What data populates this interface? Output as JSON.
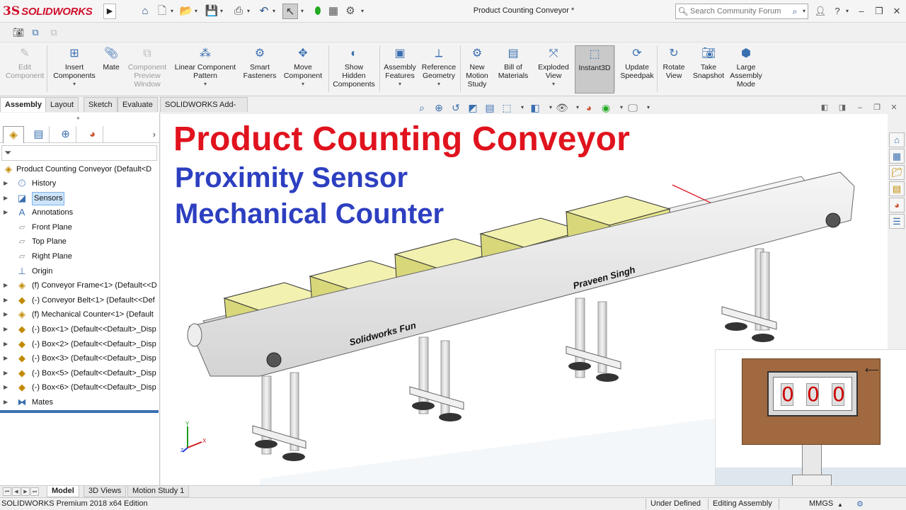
{
  "app": {
    "logo_ds": "3S",
    "logo_name": "SOLIDWORKS",
    "document_title": "Product Counting Conveyor *"
  },
  "search": {
    "placeholder": "Search Community Forum"
  },
  "ribbon": {
    "buttons": [
      {
        "label": "Edit\nComponent",
        "disabled": true
      },
      {
        "label": "Insert\nComponents",
        "dropdown": true
      },
      {
        "label": "Mate"
      },
      {
        "label": "Component\nPreview\nWindow",
        "disabled": true
      },
      {
        "label": "Linear Component\nPattern",
        "dropdown": true
      },
      {
        "label": "Smart\nFasteners"
      },
      {
        "label": "Move\nComponent",
        "dropdown": true
      },
      {
        "label": "Show\nHidden\nComponents"
      },
      {
        "label": "Assembly\nFeatures",
        "dropdown": true
      },
      {
        "label": "Reference\nGeometry",
        "dropdown": true
      },
      {
        "label": "New\nMotion\nStudy"
      },
      {
        "label": "Bill of\nMaterials"
      },
      {
        "label": "Exploded\nView",
        "dropdown": true
      },
      {
        "label": "Instant3D",
        "active": true
      },
      {
        "label": "Update\nSpeedpak"
      },
      {
        "label": "Rotate\nView"
      },
      {
        "label": "Take\nSnapshot"
      },
      {
        "label": "Large\nAssembly\nMode"
      }
    ]
  },
  "tabs": [
    "Assembly",
    "Layout",
    "Sketch",
    "Evaluate",
    "SOLIDWORKS Add-Ins"
  ],
  "tree": {
    "root": "Product Counting Conveyor  (Default<D",
    "items": [
      {
        "label": "History",
        "expandable": true
      },
      {
        "label": "Sensors",
        "expandable": true,
        "selected": true
      },
      {
        "label": "Annotations",
        "expandable": true
      },
      {
        "label": "Front Plane"
      },
      {
        "label": "Top Plane"
      },
      {
        "label": "Right Plane"
      },
      {
        "label": "Origin"
      },
      {
        "label": "(f) Conveyor Frame<1> (Default<<D",
        "expandable": true
      },
      {
        "label": "(-) Conveyor Belt<1> (Default<<Def",
        "expandable": true
      },
      {
        "label": "(f) Mechanical Counter<1> (Default",
        "expandable": true
      },
      {
        "label": "(-) Box<1> (Default<<Default>_Disp",
        "expandable": true
      },
      {
        "label": "(-) Box<2> (Default<<Default>_Disp",
        "expandable": true
      },
      {
        "label": "(-) Box<3> (Default<<Default>_Disp",
        "expandable": true
      },
      {
        "label": "(-) Box<5> (Default<<Default>_Disp",
        "expandable": true
      },
      {
        "label": "(-) Box<6> (Default<<Default>_Disp",
        "expandable": true
      },
      {
        "label": "Mates",
        "expandable": true
      }
    ]
  },
  "bottom_tabs": [
    "Model",
    "3D Views",
    "Motion Study 1"
  ],
  "status": {
    "edition": "SOLIDWORKS Premium 2018 x64 Edition",
    "defined": "Under Defined",
    "mode": "Editing Assembly",
    "units": "MMGS"
  },
  "viewport": {
    "title": "Product Counting Conveyor",
    "subtitle1": "Proximity Sensor",
    "subtitle2": "Mechanical Counter",
    "belt_text_left": "Solidworks Fun",
    "belt_text_right": "Praveen Singh",
    "triad_y": "Y",
    "triad_x": "X",
    "triad_z": "Z"
  },
  "counter": {
    "digits": [
      "0",
      "0",
      "0"
    ]
  },
  "colors": {
    "title_red": "#e0131e",
    "subtitle_blue": "#2d3fc0",
    "belt_green": "#14d414",
    "box_yellow": "#e6e58a",
    "counter_brown": "#a0693f"
  }
}
